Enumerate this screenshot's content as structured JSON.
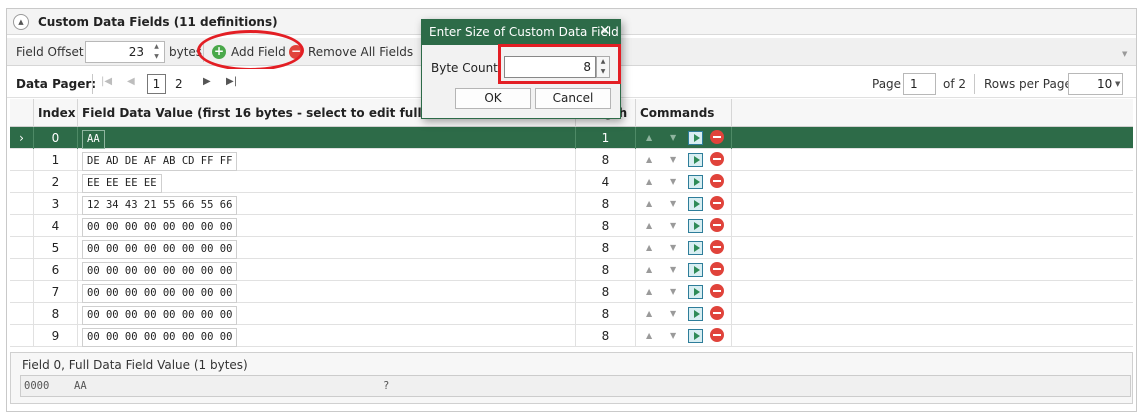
{
  "panel": {
    "title": "Custom Data Fields (11 definitions)"
  },
  "toolbar": {
    "field_offset_label": "Field Offset:",
    "field_offset_value": "23",
    "bytes_label": "bytes",
    "add_field_label": "Add Field",
    "remove_all_label": "Remove All Fields"
  },
  "pager": {
    "label": "Data Pager:",
    "pages": [
      "1",
      "2"
    ],
    "current_page": "1",
    "page_label": "Page",
    "page_input": "1",
    "of_label": "of 2",
    "rows_label": "Rows per Page:",
    "rows_value": "10"
  },
  "grid": {
    "columns": [
      "Index",
      "Field Data Value (first 16 bytes - select to edit full value)",
      "Length",
      "Commands"
    ],
    "selected_row_marker": "›",
    "rows": [
      {
        "index": "0",
        "value": "AA",
        "length": "1"
      },
      {
        "index": "1",
        "value": "DE AD DE AF AB CD FF FF",
        "length": "8"
      },
      {
        "index": "2",
        "value": "EE EE EE EE",
        "length": "4"
      },
      {
        "index": "3",
        "value": "12 34 43 21 55 66 55 66",
        "length": "8"
      },
      {
        "index": "4",
        "value": "00 00 00 00 00 00 00 00",
        "length": "8"
      },
      {
        "index": "5",
        "value": "00 00 00 00 00 00 00 00",
        "length": "8"
      },
      {
        "index": "6",
        "value": "00 00 00 00 00 00 00 00",
        "length": "8"
      },
      {
        "index": "7",
        "value": "00 00 00 00 00 00 00 00",
        "length": "8"
      },
      {
        "index": "8",
        "value": "00 00 00 00 00 00 00 00",
        "length": "8"
      },
      {
        "index": "9",
        "value": "00 00 00 00 00 00 00 00",
        "length": "8"
      }
    ]
  },
  "detail": {
    "title": "Field 0, Full Data Field Value (1 bytes)",
    "offset": "0000",
    "hex": "AA",
    "ascii": "?"
  },
  "dialog": {
    "title": "Enter Size of Custom Data Field",
    "byte_count_label": "Byte Count:",
    "byte_count_value": "8",
    "ok_label": "OK",
    "cancel_label": "Cancel"
  },
  "colors": {
    "accent_green": "#2d6b48",
    "callout_red": "#e31e24",
    "add_icon_green": "#4aa84a",
    "delete_icon_red": "#e0433b"
  },
  "icons": [
    "collapse-icon",
    "add-icon",
    "remove-icon",
    "first-page-icon",
    "prev-page-icon",
    "next-page-icon",
    "last-page-icon",
    "move-up-icon",
    "move-down-icon",
    "edit-icon",
    "delete-icon",
    "close-icon"
  ]
}
